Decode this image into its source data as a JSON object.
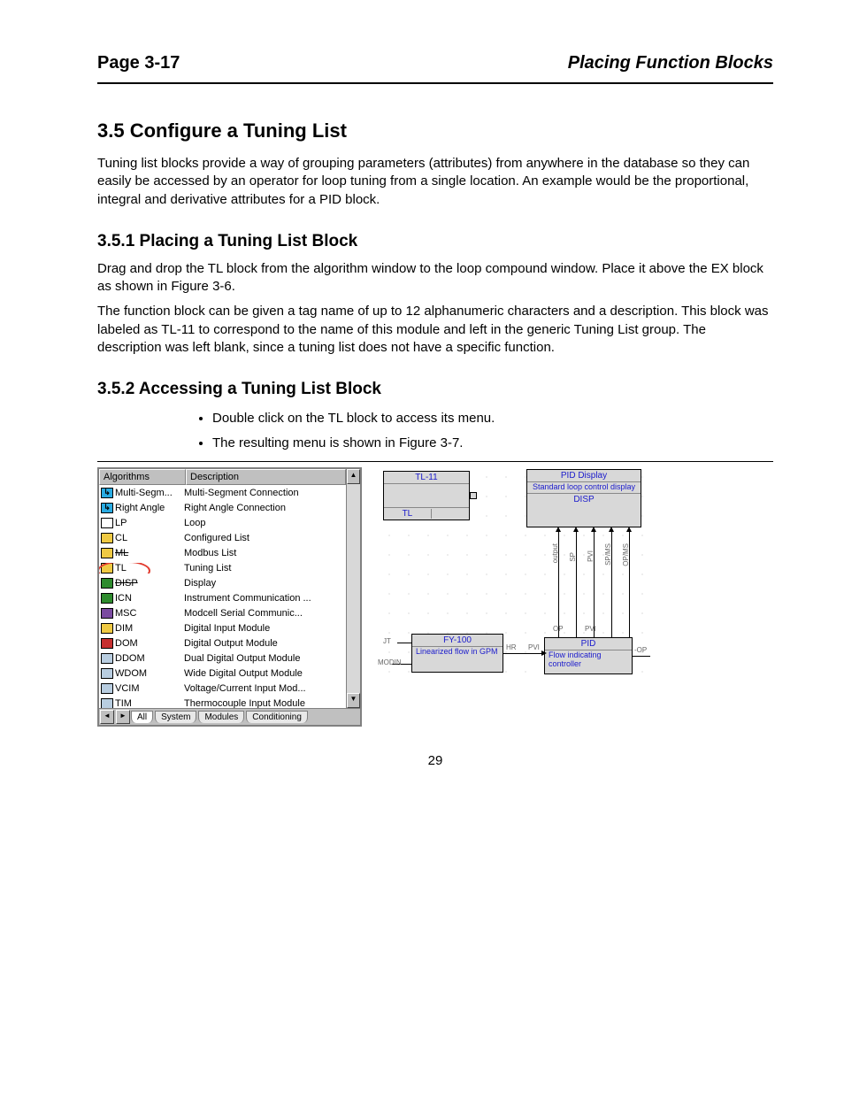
{
  "header": {
    "page_label": "Page 3-17",
    "subtitle_italic": "Placing Function Blocks"
  },
  "intro": {
    "title": "3.5   Configure a Tuning List",
    "p": "Tuning list blocks provide a way of grouping parameters (attributes) from anywhere in the database so they can easily be accessed by an operator for loop tuning from a single location.  An example would be the proportional, integral and derivative attributes for a PID block."
  },
  "sub1": {
    "title": "3.5.1   Placing a Tuning List Block",
    "p1": "Drag and drop the TL block from the algorithm window to the loop compound window. Place it above the EX block as shown in Figure 3-6.",
    "p2": "The function block can be given a tag name of up to 12 alphanumeric characters and a description.   This block was labeled as TL-11 to correspond to the name of this module and left in the generic Tuning List group.   The description was left blank, since a tuning list does not have a specific function."
  },
  "sub2": {
    "title": "3.5.2   Accessing a Tuning List Block",
    "bullet1": "Double click on the TL block to access its menu.",
    "bullet2": "The resulting menu is shown in Figure 3-7."
  },
  "panel": {
    "head_col1": "Algorithms",
    "head_col2": "Description",
    "rows": [
      {
        "code": "Multi-Segm...",
        "desc": "Multi-Segment Connection",
        "icon_bg": "#29abe2",
        "icon_txt": "↳"
      },
      {
        "code": "Right Angle",
        "desc": "Right Angle Connection",
        "icon_bg": "#29abe2",
        "icon_txt": "↳"
      },
      {
        "code": "LP",
        "desc": "Loop",
        "icon_bg": "#ffffff",
        "icon_txt": ""
      },
      {
        "code": "CL",
        "desc": "Configured List",
        "icon_bg": "#efc943",
        "icon_txt": ""
      },
      {
        "code": "ML",
        "desc": "Modbus List",
        "icon_bg": "#efc943",
        "icon_txt": "",
        "strike": true
      },
      {
        "code": "TL",
        "desc": "Tuning List",
        "icon_bg": "#efc943",
        "icon_txt": "",
        "circled": true
      },
      {
        "code": "DISP",
        "desc": "Display",
        "icon_bg": "#2e8b2e",
        "icon_txt": "",
        "strike": true
      },
      {
        "code": "ICN",
        "desc": "Instrument Communication ...",
        "icon_bg": "#2e8b2e",
        "icon_txt": ""
      },
      {
        "code": "MSC",
        "desc": "Modcell Serial Communic...",
        "icon_bg": "#7a4aa0",
        "icon_txt": ""
      },
      {
        "code": "DIM",
        "desc": "Digital Input Module",
        "icon_bg": "#efc943",
        "icon_txt": ""
      },
      {
        "code": "DOM",
        "desc": "Digital Output Module",
        "icon_bg": "#c62f2f",
        "icon_txt": ""
      },
      {
        "code": "DDOM",
        "desc": "Dual Digital Output Module",
        "icon_bg": "#b8cde0",
        "icon_txt": ""
      },
      {
        "code": "WDOM",
        "desc": "Wide Digital Output Module",
        "icon_bg": "#b8cde0",
        "icon_txt": ""
      },
      {
        "code": "VCIM",
        "desc": "Voltage/Current Input Mod...",
        "icon_bg": "#b8cde0",
        "icon_txt": ""
      },
      {
        "code": "TIM",
        "desc": "Thermocouple Input Module",
        "icon_bg": "#b8cde0",
        "icon_txt": ""
      }
    ],
    "tabs": [
      "All",
      "System",
      "Modules",
      "Conditioning"
    ]
  },
  "diagram": {
    "tl_title": "TL-11",
    "tl_foot": "TL",
    "disp_title": "PID Display",
    "disp_sub": "Standard loop control display",
    "disp_foot": "DISP",
    "fy_title": "FY-100",
    "fy_sub": "Linearized flow in GPM",
    "pid_title": "PID",
    "pid_sub": "Flow indicating controller",
    "vlabels": [
      "output",
      "SP",
      "PVI",
      "SP/MS",
      "OP/MS"
    ],
    "hlabels": {
      "jt": "JT",
      "modin": "MODIN",
      "hr": "HR",
      "pvi": "PVI",
      "op": "OP",
      "opr": "-OP"
    }
  },
  "pagenum": "29"
}
